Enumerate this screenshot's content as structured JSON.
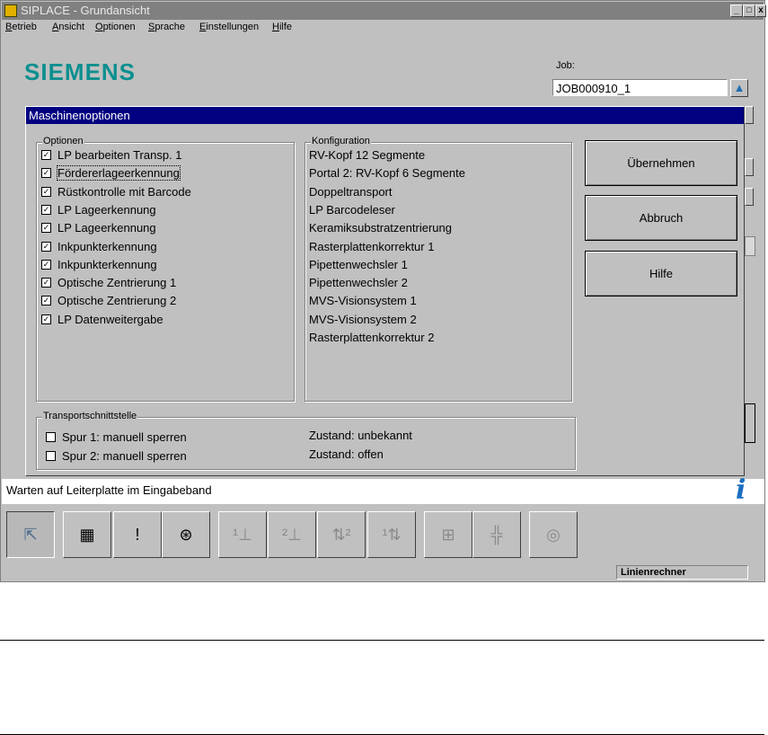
{
  "window": {
    "title": "SIPLACE - Grundansicht",
    "controls": {
      "minimize": "_",
      "maximize": "□",
      "close": "x"
    }
  },
  "menu": [
    "Betrieb",
    "Ansicht",
    "Optionen",
    "Sprache",
    "Einstellungen",
    "Hilfe"
  ],
  "brand": {
    "logo": "SIEMENS",
    "color": "#0d8f8f"
  },
  "job": {
    "label": "Job:",
    "value": "JOB000910_1"
  },
  "dialog": {
    "title": "Maschinenoptionen",
    "optionen": {
      "label": "Optionen",
      "items": [
        {
          "label": "LP bearbeiten Transp. 1",
          "checked": true
        },
        {
          "label": "Fördererlageerkennung",
          "checked": true
        },
        {
          "label": "Rüstkontrolle mit Barcode",
          "checked": true
        },
        {
          "label": "LP Lageerkennung",
          "checked": true
        },
        {
          "label": "LP Lageerkennung",
          "checked": true
        },
        {
          "label": "Inkpunkterkennung",
          "checked": true
        },
        {
          "label": "Inkpunkterkennung",
          "checked": true
        },
        {
          "label": "Optische Zentrierung 1",
          "checked": true
        },
        {
          "label": "Optische Zentrierung 2",
          "checked": true
        },
        {
          "label": "LP Datenweitergabe",
          "checked": true
        }
      ]
    },
    "konfiguration": {
      "label": "Konfiguration",
      "items": [
        "RV-Kopf 12 Segmente",
        "Portal 2: RV-Kopf 6 Segmente",
        "Doppeltransport",
        "LP Barcodeleser",
        "Keramiksubstratzentrierung",
        "Rasterplattenkorrektur 1",
        "Pipettenwechsler 1",
        "Pipettenwechsler 2",
        "MVS-Visionsystem 1",
        "MVS-Visionsystem 2",
        "Rasterplattenkorrektur 2"
      ]
    },
    "transport": {
      "label": "Transportschnittstelle",
      "items": [
        {
          "label": "Spur 1: manuell sperren",
          "checked": false,
          "state": "Zustand: unbekannt"
        },
        {
          "label": "Spur 2: manuell sperren",
          "checked": false,
          "state": "Zustand: offen"
        }
      ]
    },
    "buttons": {
      "apply": "Übernehmen",
      "cancel": "Abbruch",
      "help": "Hilfe"
    }
  },
  "status": {
    "message": "Warten auf Leiterplatte im Eingabeband",
    "icon": "info-icon"
  },
  "toolbar": [
    {
      "icon": "pointer-icon",
      "glyph": "⇱",
      "state": "pressed"
    },
    {
      "icon": "feeder-table-icon",
      "glyph": "▦",
      "state": "enabled"
    },
    {
      "icon": "warning-list-icon",
      "glyph": "!",
      "state": "enabled"
    },
    {
      "icon": "component-reel-icon",
      "glyph": "⊛",
      "state": "enabled"
    },
    {
      "icon": "placement-head-1-icon",
      "glyph": "¹⊥",
      "state": "disabled"
    },
    {
      "icon": "placement-head-2-icon",
      "glyph": "²⊥",
      "state": "disabled"
    },
    {
      "icon": "transport-2-icon",
      "glyph": "⇅²",
      "state": "disabled"
    },
    {
      "icon": "transport-1-icon",
      "glyph": "¹⇅",
      "state": "disabled"
    },
    {
      "icon": "board-add-icon",
      "glyph": "⊞",
      "state": "disabled"
    },
    {
      "icon": "component-chip-icon",
      "glyph": "╬",
      "state": "disabled"
    },
    {
      "icon": "vision-camera-icon",
      "glyph": "◎",
      "state": "disabled"
    }
  ],
  "statusbar": {
    "computer": "Linienrechner"
  }
}
